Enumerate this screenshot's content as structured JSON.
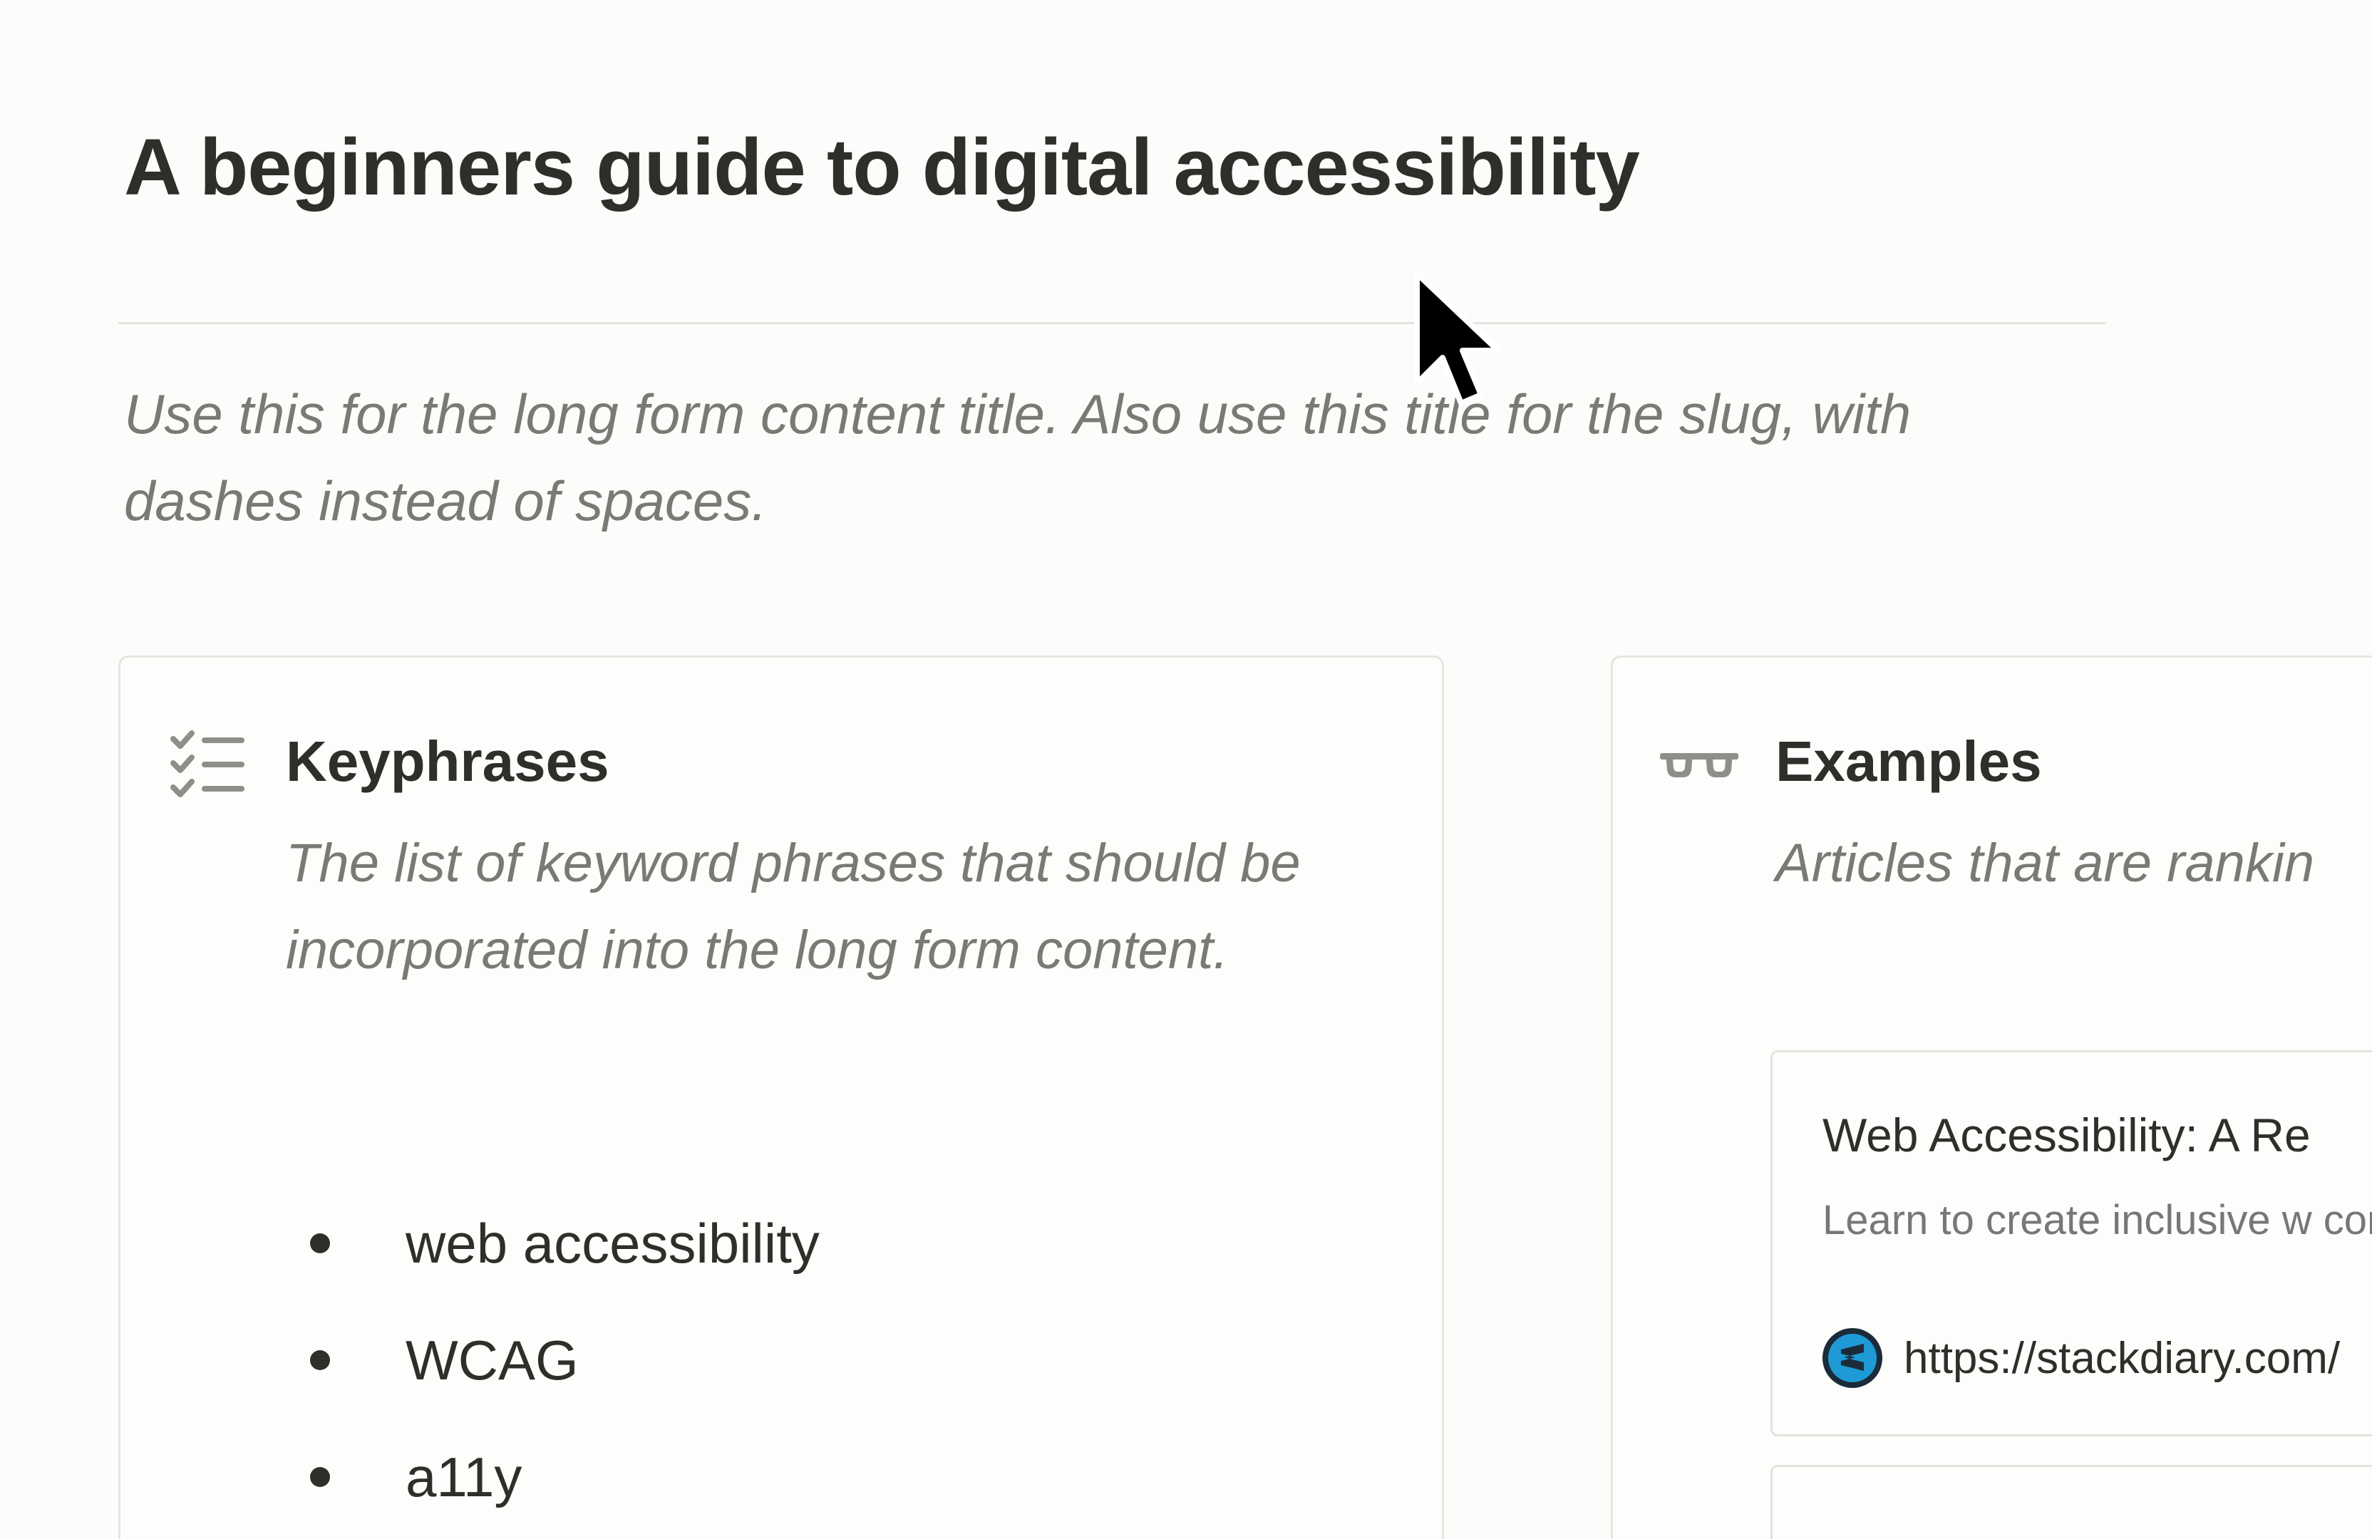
{
  "page": {
    "title": "A beginners guide to digital accessibility",
    "subtitle": "Use this for the long form content title. Also use this title for the slug, with dashes instead of spaces."
  },
  "keyphrases": {
    "icon": "checklist-icon",
    "heading": "Keyphrases",
    "description": "The list of keyword phrases that should be incorporated into the long form content.",
    "items": [
      "web accessibility",
      "WCAG",
      "a11y"
    ]
  },
  "examples": {
    "icon": "glasses-icon",
    "heading": "Examples",
    "description": "Articles that are rankin",
    "bookmarks": [
      {
        "title": "Web Accessibility: A Re",
        "description": "Learn to create inclusive w comprehensive guide on w",
        "url": "https://stackdiary.com/",
        "favicon": "stackdiary-logo-icon"
      }
    ]
  },
  "colors": {
    "background": "#fcfcfb",
    "text": "#2f2e2b",
    "muted": "#7a7975",
    "border": "#e6e5e2",
    "favicon": "#1e9bd6"
  }
}
